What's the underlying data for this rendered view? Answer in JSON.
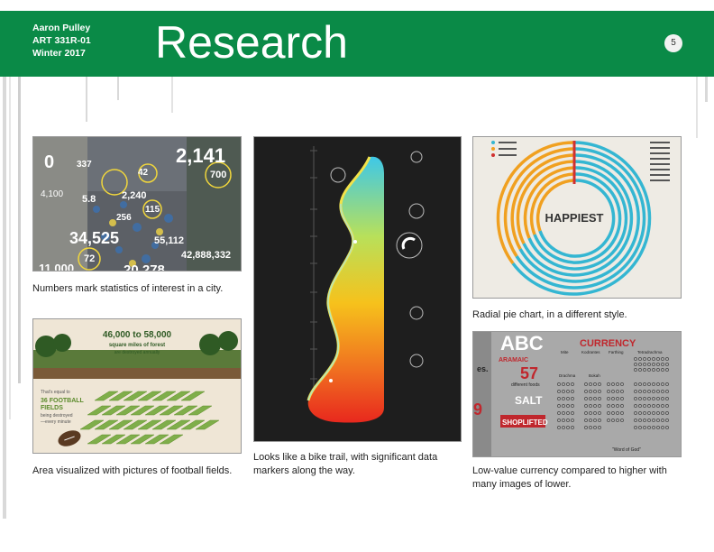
{
  "header": {
    "author_name": "Aaron Pulley",
    "course": "ART 331R-01",
    "term": "Winter 2017",
    "title": "Research",
    "page_number": "5"
  },
  "images": {
    "city_stats": {
      "numbers": [
        "0",
        "337",
        "2,141",
        "42",
        "700",
        "4,100",
        "5.8",
        "2,240",
        "115",
        "256",
        "34,525",
        "55,112",
        "72",
        "42,888,332",
        "11,000",
        "20,278"
      ],
      "caption": "Numbers mark statistics of interest in a city."
    },
    "forest": {
      "headline_number": "46,000 to 58,000",
      "headline_text": "square miles of forest",
      "headline_sub": "are destroyed annually",
      "side_intro": "That's equal to",
      "side_number": "36 FOOTBALL",
      "side_fields": "FIELDS",
      "side_rest": "being destroyed",
      "side_rest2": "—every minute",
      "caption": "Area visualized with pictures of football fields."
    },
    "bike_trail": {
      "caption": "Looks like a bike trail, with significant data markers along the way."
    },
    "radial": {
      "center_label": "HAPPIEST",
      "caption": "Radial pie chart, in a different style."
    },
    "currency": {
      "top_left": "ABC",
      "aramaic": "ARAMAIC",
      "title": "CURRENCY",
      "number_57": "57",
      "different_foods": "different foods",
      "salt": "SALT",
      "shoplifted": "SHOPLIFTED",
      "word_of_god": "\"Word of God\"",
      "columns": [
        "Mite",
        "Kodrantes",
        "Farthing",
        "Tetradrachma",
        "Drachma",
        "Bokah"
      ],
      "caption": "Low-value currency compared to higher with many images of lower."
    }
  }
}
